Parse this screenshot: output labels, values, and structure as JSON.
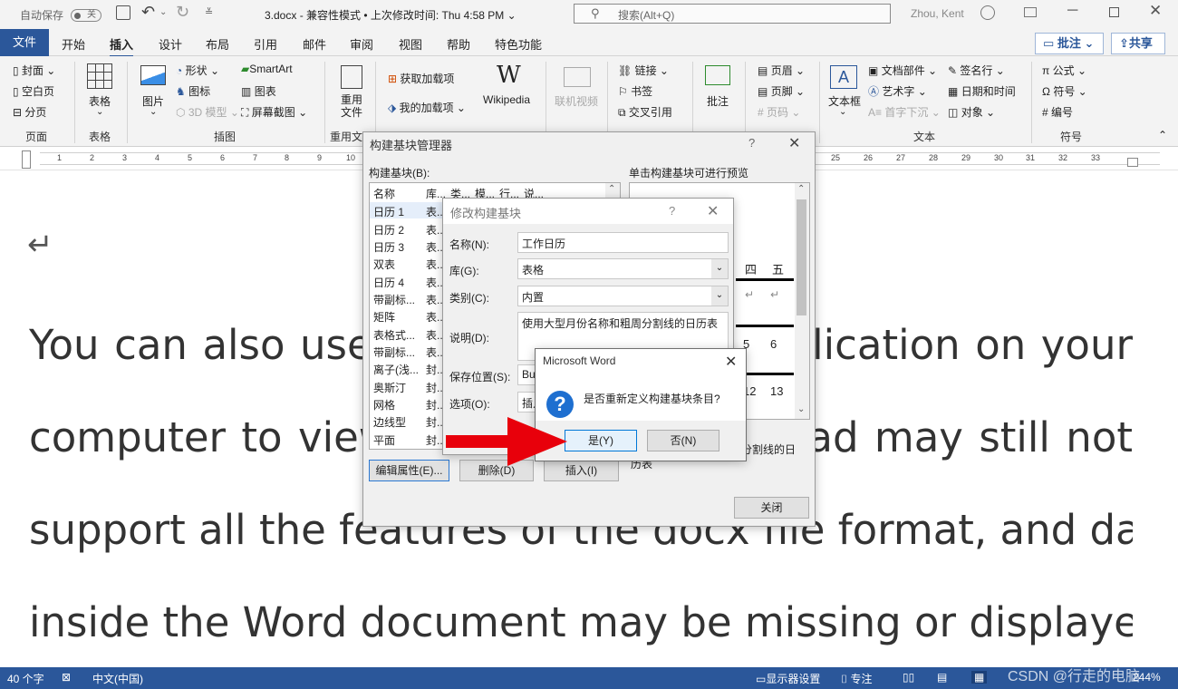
{
  "title_bar": {
    "autosave_label": "自动保存",
    "autosave_state": "关",
    "doc_title": "3.docx  -  兼容性模式 • 上次修改时间: Thu 4:58 PM  ⌄",
    "search_placeholder": "搜索(Alt+Q)",
    "user_name": "Zhou, Kent"
  },
  "tabs": [
    "文件",
    "开始",
    "插入",
    "设计",
    "布局",
    "引用",
    "邮件",
    "审阅",
    "视图",
    "帮助",
    "特色功能"
  ],
  "active_tab": "插入",
  "top_buttons": {
    "comments": "批注",
    "share": "共享"
  },
  "ribbon": {
    "pages": {
      "cover": "封面",
      "blank": "空白页",
      "break": "分页",
      "group": "页面"
    },
    "tables": {
      "table": "表格",
      "group": "表格"
    },
    "illustrations": {
      "pictures": "图片",
      "shapes": "形状",
      "icons": "图标",
      "3d": "3D 模型",
      "smartart": "SmartArt",
      "chart": "图表",
      "screenshot": "屏幕截图",
      "group": "插图"
    },
    "reuse": {
      "reuse_files": "重用文件",
      "group": "重用文"
    },
    "addins": {
      "get": "获取加载项",
      "my": "我的加载项",
      "wikipedia": "Wikipedia"
    },
    "media": {
      "online_video": "联机视频"
    },
    "links": {
      "link": "链接",
      "bookmark": "书签",
      "crossref": "交叉引用"
    },
    "comments": {
      "comment": "批注"
    },
    "header_footer": {
      "header": "页眉",
      "footer": "页脚",
      "page_number": "页码"
    },
    "text": {
      "textbox": "文本框",
      "quickparts": "文档部件",
      "wordart": "艺术字",
      "dropcap": "首字下沉",
      "signature": "签名行",
      "datetime": "日期和时间",
      "object": "对象",
      "group": "文本"
    },
    "symbols": {
      "equation": "公式",
      "symbol": "符号",
      "number": "编号",
      "group": "符号"
    }
  },
  "ruler_numbers_left": [
    "1",
    "2",
    "3",
    "4",
    "5",
    "6",
    "7",
    "8",
    "9",
    "10"
  ],
  "ruler_numbers_right": [
    "25",
    "26",
    "27",
    "28",
    "29",
    "30",
    "31",
    "32",
    "33"
  ],
  "document": {
    "para_mark": "↵",
    "lines": [
      "You can also use the Word Online application on your",
      "computer to view the file. Word for iPad may still not",
      "support all the features of the docx file format, and data",
      "inside the Word document may be missing or displayed"
    ]
  },
  "bb_manager": {
    "title": "构建基块管理器",
    "help": "?",
    "list_label": "构建基块(B):",
    "preview_label": "单击构建基块可进行预览",
    "columns": [
      "名称",
      "库...",
      "类...",
      "模...",
      "行...",
      "说..."
    ],
    "rows": [
      {
        "name": "日历 1",
        "lib": "表..."
      },
      {
        "name": "日历 2",
        "lib": "表..."
      },
      {
        "name": "日历 3",
        "lib": "表..."
      },
      {
        "name": "双表",
        "lib": "表..."
      },
      {
        "name": "日历 4",
        "lib": "表..."
      },
      {
        "name": "带副标...",
        "lib": "表..."
      },
      {
        "name": "矩阵",
        "lib": "表..."
      },
      {
        "name": "表格式...",
        "lib": "表..."
      },
      {
        "name": "带副标...",
        "lib": "表..."
      },
      {
        "name": "离子(浅...",
        "lib": "封..."
      },
      {
        "name": "奥斯汀",
        "lib": "封..."
      },
      {
        "name": "网格",
        "lib": "封..."
      },
      {
        "name": "边线型",
        "lib": "封..."
      },
      {
        "name": "平面",
        "lib": "封..."
      }
    ],
    "preview_cells_row1": [
      "四",
      "五"
    ],
    "preview_cells_row2": [
      "5",
      "6"
    ],
    "preview_cells_row3": [
      "12",
      "13"
    ],
    "description_partial": "分割线的日",
    "description_partial2": "历表",
    "btn_edit": "编辑属性(E)...",
    "btn_delete": "删除(D)",
    "btn_insert": "插入(I)",
    "btn_close": "关闭"
  },
  "modify_dialog": {
    "title": "修改构建基块",
    "help": "?",
    "name_label": "名称(N):",
    "name_value": "工作日历",
    "gallery_label": "库(G):",
    "gallery_value": "表格",
    "category_label": "类别(C):",
    "category_value": "内置",
    "desc_label": "说明(D):",
    "desc_value": "使用大型月份名称和粗周分割线的日历表",
    "save_label": "保存位置(S):",
    "save_value": "Bu",
    "options_label": "选项(O):",
    "options_value": "插入"
  },
  "confirm_dialog": {
    "title": "Microsoft Word",
    "message": "是否重新定义构建基块条目?",
    "yes": "是(Y)",
    "no": "否(N)"
  },
  "status_bar": {
    "word_count": "40 个字",
    "language": "中文(中国)",
    "display_settings": "显示器设置",
    "focus": "专注",
    "zoom": "244%"
  },
  "watermark": "CSDN @行走的电脑",
  "colors": {
    "brand": "#2b579a",
    "arrow": "#e8000b",
    "help_icon": "#1e6fd0"
  }
}
